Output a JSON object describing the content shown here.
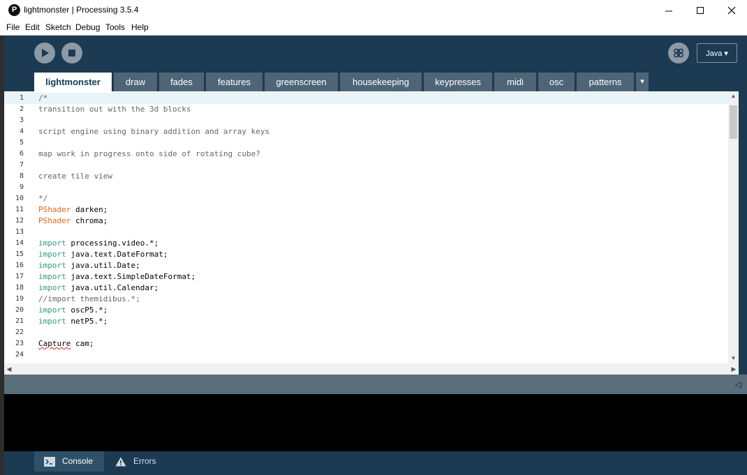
{
  "window": {
    "title": "lightmonster | Processing 3.5.4",
    "app_icon": "P"
  },
  "menu": [
    "File",
    "Edit",
    "Sketch",
    "Debug",
    "Tools",
    "Help"
  ],
  "toolbar": {
    "mode_label": "Java ▾"
  },
  "tabs": [
    "lightmonster",
    "draw",
    "fades",
    "features",
    "greenscreen",
    "housekeeping",
    "keypresses",
    "midi",
    "osc",
    "patterns"
  ],
  "tab_more": "▾",
  "code_lines": [
    {
      "n": "1",
      "t": "/*",
      "c": "comment"
    },
    {
      "n": "2",
      "t": "transition out with the 3d blocks",
      "c": "comment"
    },
    {
      "n": "3",
      "t": "",
      "c": "comment"
    },
    {
      "n": "4",
      "t": "script engine using binary addition and array keys",
      "c": "comment"
    },
    {
      "n": "5",
      "t": "",
      "c": "comment"
    },
    {
      "n": "6",
      "t": "map work in progress onto side of rotating cube?",
      "c": "comment"
    },
    {
      "n": "7",
      "t": "",
      "c": "comment"
    },
    {
      "n": "8",
      "t": "create tile view",
      "c": "comment"
    },
    {
      "n": "9",
      "t": "",
      "c": "comment"
    },
    {
      "n": "10",
      "t": "*/",
      "c": "comment"
    },
    {
      "n": "11",
      "k": "PShader",
      "t": " darken;",
      "c": "type"
    },
    {
      "n": "12",
      "k": "PShader",
      "t": " chroma;",
      "c": "type"
    },
    {
      "n": "13",
      "t": "",
      "c": "plain"
    },
    {
      "n": "14",
      "k": "import",
      "t": " processing.video.*;",
      "c": "kw"
    },
    {
      "n": "15",
      "k": "import",
      "t": " java.text.DateFormat;",
      "c": "kw"
    },
    {
      "n": "16",
      "k": "import",
      "t": " java.util.Date;",
      "c": "kw"
    },
    {
      "n": "17",
      "k": "import",
      "t": " java.text.SimpleDateFormat;",
      "c": "kw"
    },
    {
      "n": "18",
      "k": "import",
      "t": " java.util.Calendar;",
      "c": "kw"
    },
    {
      "n": "19",
      "t": "//import themidibus.*;",
      "c": "comment"
    },
    {
      "n": "20",
      "k": "import",
      "t": " oscP5.*;",
      "c": "kw"
    },
    {
      "n": "21",
      "k": "import",
      "t": " netP5.*;",
      "c": "kw"
    },
    {
      "n": "22",
      "t": "",
      "c": "plain"
    },
    {
      "n": "23",
      "k": "Capture",
      "t": " cam;",
      "c": "squiggle"
    },
    {
      "n": "24",
      "t": "",
      "c": "plain"
    }
  ],
  "bottom_tabs": {
    "console": "Console",
    "errors": "Errors"
  },
  "colors": {
    "toolbar_bg": "#1c3a52",
    "tab_bg": "#4d6577",
    "comment": "#666666",
    "type": "#e2661a",
    "keyword": "#33997e"
  }
}
